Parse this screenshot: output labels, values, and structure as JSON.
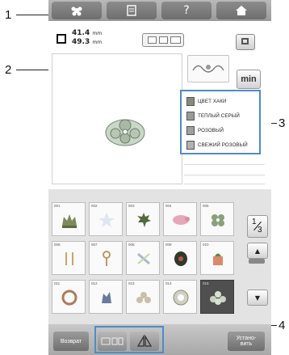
{
  "callouts": [
    "1",
    "2",
    "3",
    "4"
  ],
  "toolbar": {
    "icons": [
      "flower-icon",
      "document-icon",
      "help-icon",
      "home-icon"
    ],
    "help_glyph": "?"
  },
  "size": {
    "width": "41.4",
    "height": "49.3",
    "unit": "mm"
  },
  "buttons": {
    "min": "min",
    "back": "Возврат",
    "set": "Устано-\nвить"
  },
  "thread_colors": [
    {
      "name": "ЦВЕТ ХАКИ",
      "color": "#8a8a7a"
    },
    {
      "name": "ТЕПЛЫЙ СЕРЫЙ",
      "color": "#9a9a96"
    },
    {
      "name": "РОЗОВЫЙ",
      "color": "#a0a0a0"
    },
    {
      "name": "СВЕЖИЙ РОЗОВЫЙ",
      "color": "#b2b2b2"
    }
  ],
  "patterns": [
    {
      "num": "001",
      "icon": "crown-icon"
    },
    {
      "num": "002",
      "icon": "star-icon"
    },
    {
      "num": "003",
      "icon": "maple-leaf-icon"
    },
    {
      "num": "004",
      "icon": "pig-icon"
    },
    {
      "num": "005",
      "icon": "flower-icon"
    },
    {
      "num": "006",
      "icon": "dragonfly-icon"
    },
    {
      "num": "007",
      "icon": "key-icon"
    },
    {
      "num": "008",
      "icon": "dragonfly-icon"
    },
    {
      "num": "009",
      "icon": "leaf-icon"
    },
    {
      "num": "010",
      "icon": "mug-icon"
    },
    {
      "num": "011",
      "icon": "wreath-icon"
    },
    {
      "num": "012",
      "icon": "lion-icon"
    },
    {
      "num": "013",
      "icon": "flower-ornament-icon"
    },
    {
      "num": "014",
      "icon": "round-ornament-icon"
    },
    {
      "num": "015",
      "icon": "lace-ornament-icon",
      "selected": true
    }
  ],
  "pager": {
    "current": "1",
    "total": "3"
  },
  "colors": {
    "accent": "#4e8cc8",
    "selected_cell": "#4f4f4f"
  }
}
